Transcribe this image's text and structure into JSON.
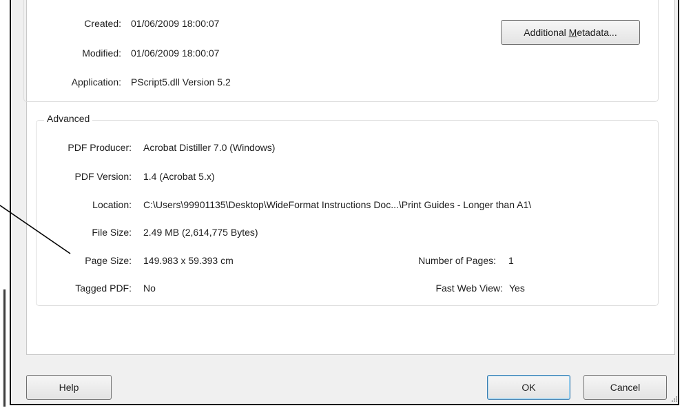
{
  "description": {
    "created_label": "Created:",
    "created_value": "01/06/2009 18:00:07",
    "modified_label": "Modified:",
    "modified_value": "01/06/2009 18:00:07",
    "application_label": "Application:",
    "application_value": "PScript5.dll Version 5.2",
    "additional_metadata_button_pre": "Additional ",
    "additional_metadata_button_mnemonic": "M",
    "additional_metadata_button_post": "etadata..."
  },
  "advanced": {
    "group_title": "Advanced",
    "pdf_producer_label": "PDF Producer:",
    "pdf_producer_value": "Acrobat Distiller 7.0 (Windows)",
    "pdf_version_label": "PDF Version:",
    "pdf_version_value": "1.4 (Acrobat 5.x)",
    "location_label": "Location:",
    "location_value": "C:\\Users\\99901135\\Desktop\\WideFormat Instructions Doc...\\Print Guides - Longer than A1\\",
    "file_size_label": "File Size:",
    "file_size_value": "2.49 MB (2,614,775 Bytes)",
    "page_size_label": "Page Size:",
    "page_size_value": "149.983 x 59.393 cm",
    "number_of_pages_label": "Number of Pages:",
    "number_of_pages_value": "1",
    "tagged_pdf_label": "Tagged PDF:",
    "tagged_pdf_value": "No",
    "fast_web_view_label": "Fast Web View:",
    "fast_web_view_value": "Yes"
  },
  "footer": {
    "help_label": "Help",
    "ok_label": "OK",
    "cancel_label": "Cancel"
  },
  "colors": {
    "dialog_bg": "#f0f0f0",
    "panel_bg": "#ffffff",
    "default_button_border": "#3c7fb1"
  }
}
